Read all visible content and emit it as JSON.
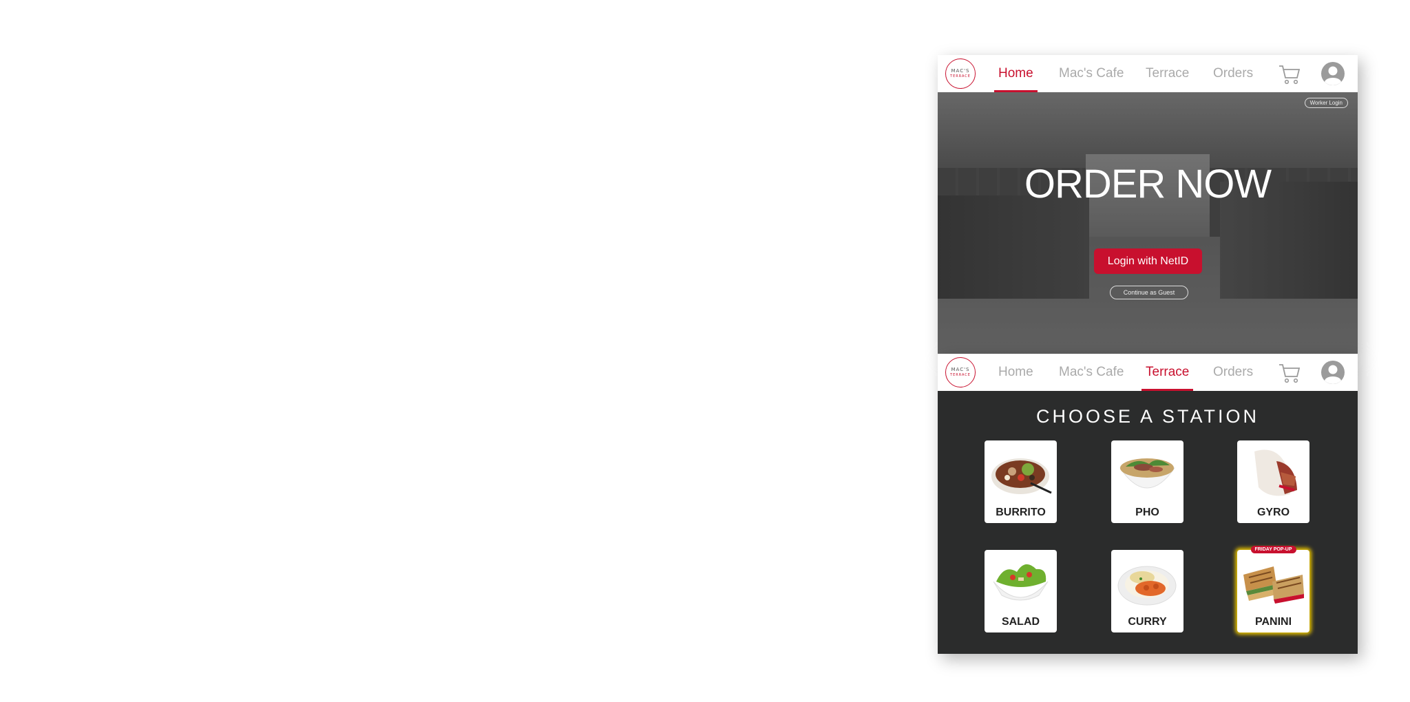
{
  "logo": {
    "line1": "MAC'S",
    "line2": "TERRACE"
  },
  "top_nav": {
    "items": [
      "Home",
      "Mac's Cafe",
      "Terrace",
      "Orders"
    ],
    "active": "Home"
  },
  "hero": {
    "worker_login": "Worker Login",
    "headline": "ORDER NOW",
    "login_button": "Login with NetID",
    "guest_button": "Continue as Guest"
  },
  "second_nav": {
    "items": [
      "Home",
      "Mac's Cafe",
      "Terrace",
      "Orders"
    ],
    "active": "Terrace"
  },
  "stations": {
    "title": "CHOOSE A STATION",
    "cards": [
      {
        "label": "BURRITO",
        "icon": "burrito-bowl-image"
      },
      {
        "label": "PHO",
        "icon": "pho-bowl-image"
      },
      {
        "label": "GYRO",
        "icon": "gyro-image"
      },
      {
        "label": "SALAD",
        "icon": "salad-image"
      },
      {
        "label": "CURRY",
        "icon": "curry-image"
      },
      {
        "label": "PANINI",
        "icon": "panini-image",
        "badge": "FRIDAY POP-UP"
      }
    ]
  },
  "colors": {
    "accent": "#c8102e",
    "dark_bg": "#2b2c2c",
    "nav_inactive": "#aaaaaa",
    "highlight": "#e8c300"
  }
}
